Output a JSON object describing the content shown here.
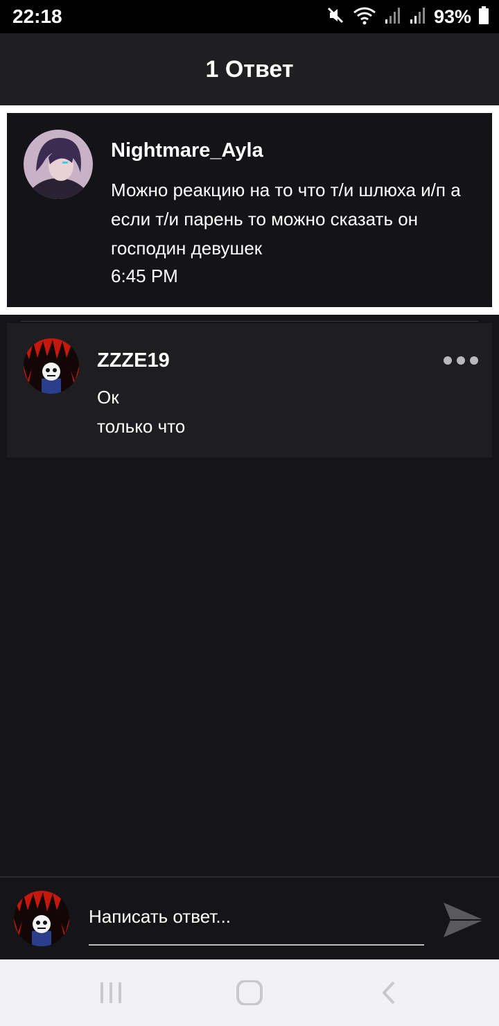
{
  "status_bar": {
    "time": "22:18",
    "battery_percent": "93%",
    "icons": [
      "mute-icon",
      "wifi-icon",
      "signal-icon",
      "signal-icon",
      "battery-icon"
    ]
  },
  "header": {
    "title": "1 Ответ"
  },
  "parent_comment": {
    "author": "Nightmare_Ayla",
    "text": "Можно реакцию на то что т/и шлюха и/п а если т/и парень то можно сказать он господин девушек",
    "time": "6:45 PM"
  },
  "reply": {
    "author": "ZZZE19",
    "text": "Ок",
    "time": "только что",
    "more_icon": "more-dots-icon"
  },
  "composer": {
    "placeholder": "Написать ответ...",
    "send_icon": "send-icon"
  },
  "nav_bar": {
    "buttons": [
      "recent-apps-icon",
      "home-icon",
      "back-icon"
    ]
  },
  "colors": {
    "background": "#151417",
    "header": "#1f1f21",
    "parent_frame": "#ffffff",
    "reply_card": "#1e1e21",
    "avatar_red": "#c4180d",
    "nav_bar": "#f2f2f4"
  }
}
